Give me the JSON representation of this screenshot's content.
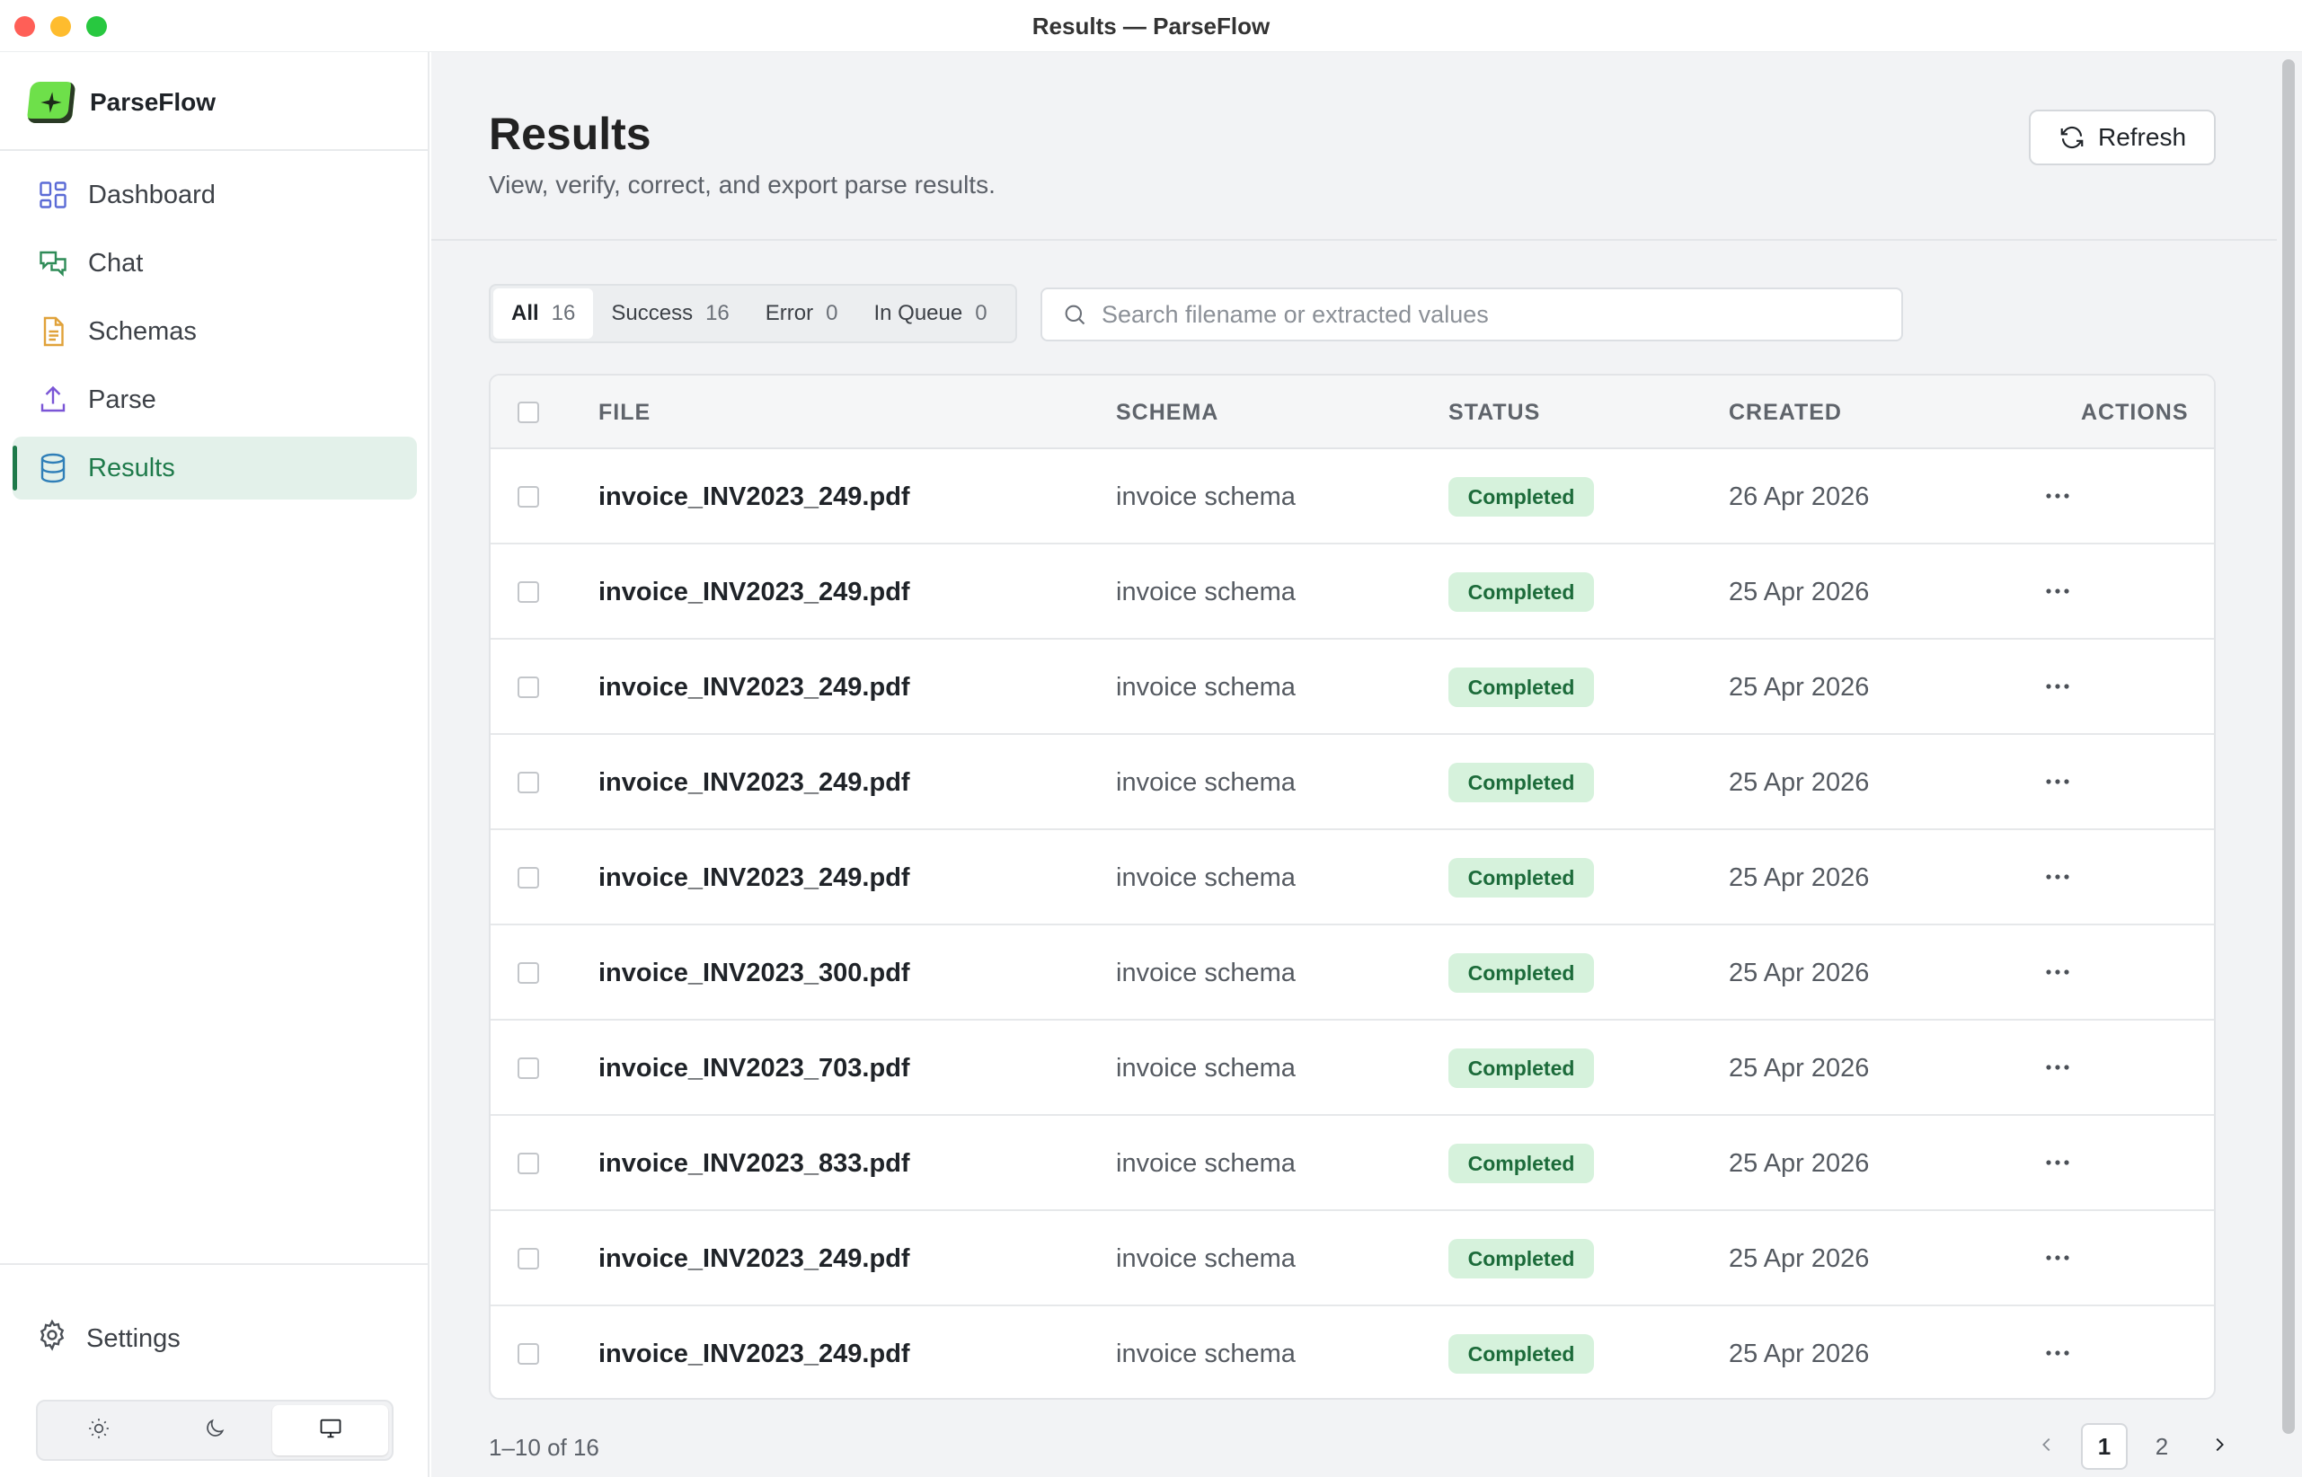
{
  "window": {
    "title": "Results — ParseFlow"
  },
  "brand": {
    "name": "ParseFlow"
  },
  "sidebar": {
    "items": [
      {
        "label": "Dashboard",
        "icon": "dashboard-grid-icon"
      },
      {
        "label": "Chat",
        "icon": "chat-bubbles-icon"
      },
      {
        "label": "Schemas",
        "icon": "document-icon"
      },
      {
        "label": "Parse",
        "icon": "upload-icon"
      },
      {
        "label": "Results",
        "icon": "database-icon",
        "active": true
      }
    ],
    "settings_label": "Settings",
    "theme_options": [
      "light",
      "dark",
      "system"
    ],
    "theme_selected": "system"
  },
  "header": {
    "title": "Results",
    "subtitle": "View, verify, correct, and export parse results.",
    "refresh_label": "Refresh"
  },
  "filters": [
    {
      "label": "All",
      "count": "16",
      "active": true
    },
    {
      "label": "Success",
      "count": "16"
    },
    {
      "label": "Error",
      "count": "0"
    },
    {
      "label": "In Queue",
      "count": "0"
    }
  ],
  "search": {
    "placeholder": "Search filename or extracted values",
    "value": ""
  },
  "table": {
    "columns": [
      "FILE",
      "SCHEMA",
      "STATUS",
      "CREATED",
      "ACTIONS"
    ],
    "rows": [
      {
        "file": "invoice_INV2023_249.pdf",
        "schema": "invoice schema",
        "status": "Completed",
        "created": "26 Apr 2026"
      },
      {
        "file": "invoice_INV2023_249.pdf",
        "schema": "invoice schema",
        "status": "Completed",
        "created": "25 Apr 2026"
      },
      {
        "file": "invoice_INV2023_249.pdf",
        "schema": "invoice schema",
        "status": "Completed",
        "created": "25 Apr 2026"
      },
      {
        "file": "invoice_INV2023_249.pdf",
        "schema": "invoice schema",
        "status": "Completed",
        "created": "25 Apr 2026"
      },
      {
        "file": "invoice_INV2023_249.pdf",
        "schema": "invoice schema",
        "status": "Completed",
        "created": "25 Apr 2026"
      },
      {
        "file": "invoice_INV2023_300.pdf",
        "schema": "invoice schema",
        "status": "Completed",
        "created": "25 Apr 2026"
      },
      {
        "file": "invoice_INV2023_703.pdf",
        "schema": "invoice schema",
        "status": "Completed",
        "created": "25 Apr 2026"
      },
      {
        "file": "invoice_INV2023_833.pdf",
        "schema": "invoice schema",
        "status": "Completed",
        "created": "25 Apr 2026"
      },
      {
        "file": "invoice_INV2023_249.pdf",
        "schema": "invoice schema",
        "status": "Completed",
        "created": "25 Apr 2026"
      },
      {
        "file": "invoice_INV2023_249.pdf",
        "schema": "invoice schema",
        "status": "Completed",
        "created": "25 Apr 2026"
      }
    ]
  },
  "pagination": {
    "info": "1–10 of 16",
    "pages": [
      "1",
      "2"
    ],
    "current": "1"
  },
  "colors": {
    "accent": "#1e7a4a",
    "active_bg": "#e3f1ea",
    "badge_bg": "#d6f2dc",
    "badge_text": "#1c6b3a",
    "brand": "#6ee04a"
  }
}
